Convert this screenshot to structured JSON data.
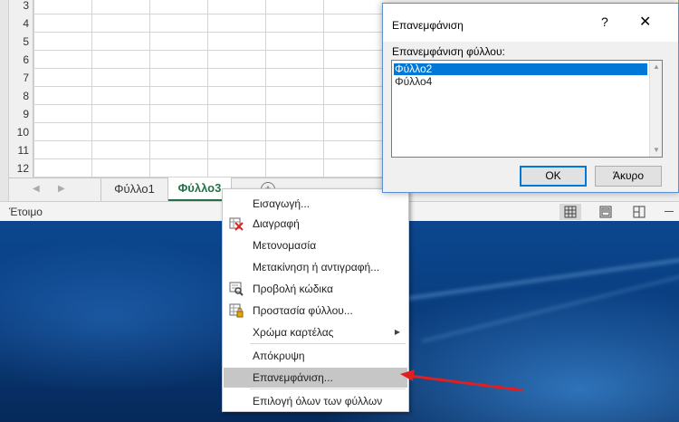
{
  "grid": {
    "rows": [
      "3",
      "4",
      "5",
      "6",
      "7",
      "8",
      "9",
      "10",
      "11",
      "12"
    ]
  },
  "sheet_tabs": {
    "tabs": [
      {
        "label": "Φύλλο1",
        "active": false
      },
      {
        "label": "Φύλλο3",
        "active": true
      }
    ],
    "add_label": "+"
  },
  "status_bar": {
    "status": "Έτοιμο"
  },
  "context_menu": {
    "items": [
      {
        "label": "Εισαγωγή...",
        "icon": "none",
        "disabled": false
      },
      {
        "label": "Διαγραφή",
        "icon": "delete-sheet-icon",
        "disabled": false
      },
      {
        "label": "Μετονομασία",
        "icon": "none",
        "disabled": false
      },
      {
        "label": "Μετακίνηση ή αντιγραφή...",
        "icon": "none",
        "disabled": false
      },
      {
        "label": "Προβολή κώδικα",
        "icon": "view-code-icon",
        "disabled": false
      },
      {
        "label": "Προστασία φύλλου...",
        "icon": "protect-sheet-icon",
        "disabled": false
      },
      {
        "label": "Χρώμα καρτέλας",
        "icon": "none",
        "disabled": false,
        "submenu": true
      },
      {
        "label": "Απόκρυψη",
        "icon": "none",
        "disabled": false
      },
      {
        "label": "Επανεμφάνιση...",
        "icon": "none",
        "disabled": false,
        "highlighted": true
      },
      {
        "label": "Επιλογή όλων των φύλλων",
        "icon": "none",
        "disabled": false
      }
    ]
  },
  "dialog": {
    "title": "Επανεμφάνιση",
    "help_label": "?",
    "close_label": "✕",
    "list_label": "Επανεμφάνιση φύλλου:",
    "list_items": [
      {
        "label": "Φύλλο2",
        "selected": true
      },
      {
        "label": "Φύλλο4",
        "selected": false
      }
    ],
    "ok_label": "OK",
    "cancel_label": "Άκυρο"
  },
  "colors": {
    "excel_green": "#217346",
    "selection_blue": "#0078d7",
    "annotation_red": "#e02020"
  }
}
